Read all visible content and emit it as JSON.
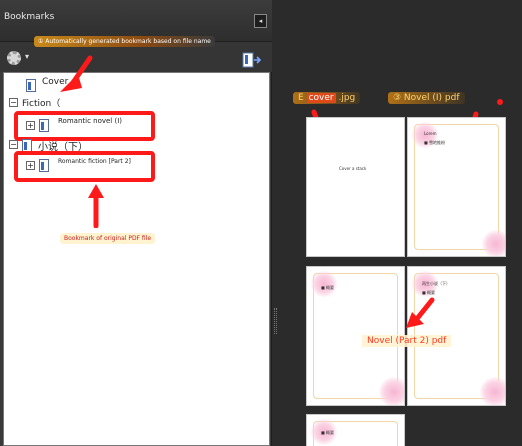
{
  "panel": {
    "title": "Bookmarks",
    "collapse_glyph": "◂",
    "gear_caret": "▾",
    "icons": [
      "gear-icon",
      "export-bookmark-icon",
      "collapse-panel-icon",
      "document-bookmark-icon"
    ]
  },
  "tree": {
    "cover": "Cover",
    "fiction": "Fiction（",
    "novel1": "Romantic novel (I)",
    "cjk_group": "小说（下）",
    "fiction2": "Romantic fiction [Part 2]",
    "collapse_glyph": "−",
    "expand_glyph": "+"
  },
  "annotations": {
    "top": "① Automatically generated bookmark based on file name",
    "bottom": "Bookmark of original PDF file"
  },
  "pages": {
    "label_cover_prefix": "E",
    "label_cover_highlight": "cover",
    "label_cover_suffix": ".jpg",
    "label_novel1": "③ Novel (I) pdf",
    "label_novel2": "Novel (Part 2) pdf",
    "cover_text": "Cover a stack",
    "p2_lines": [
      "Lorem",
      "■ 雪地推粉"
    ],
    "p3_line": "■ 概要",
    "p4_title": "再生小说（下）",
    "p4_line": "■ 概要",
    "p5_line": "■ 概要"
  },
  "colors": {
    "accent_red": "#ff1a1a",
    "panel_bg": "#3a3a3a",
    "workspace_bg": "#2b2b2b"
  }
}
